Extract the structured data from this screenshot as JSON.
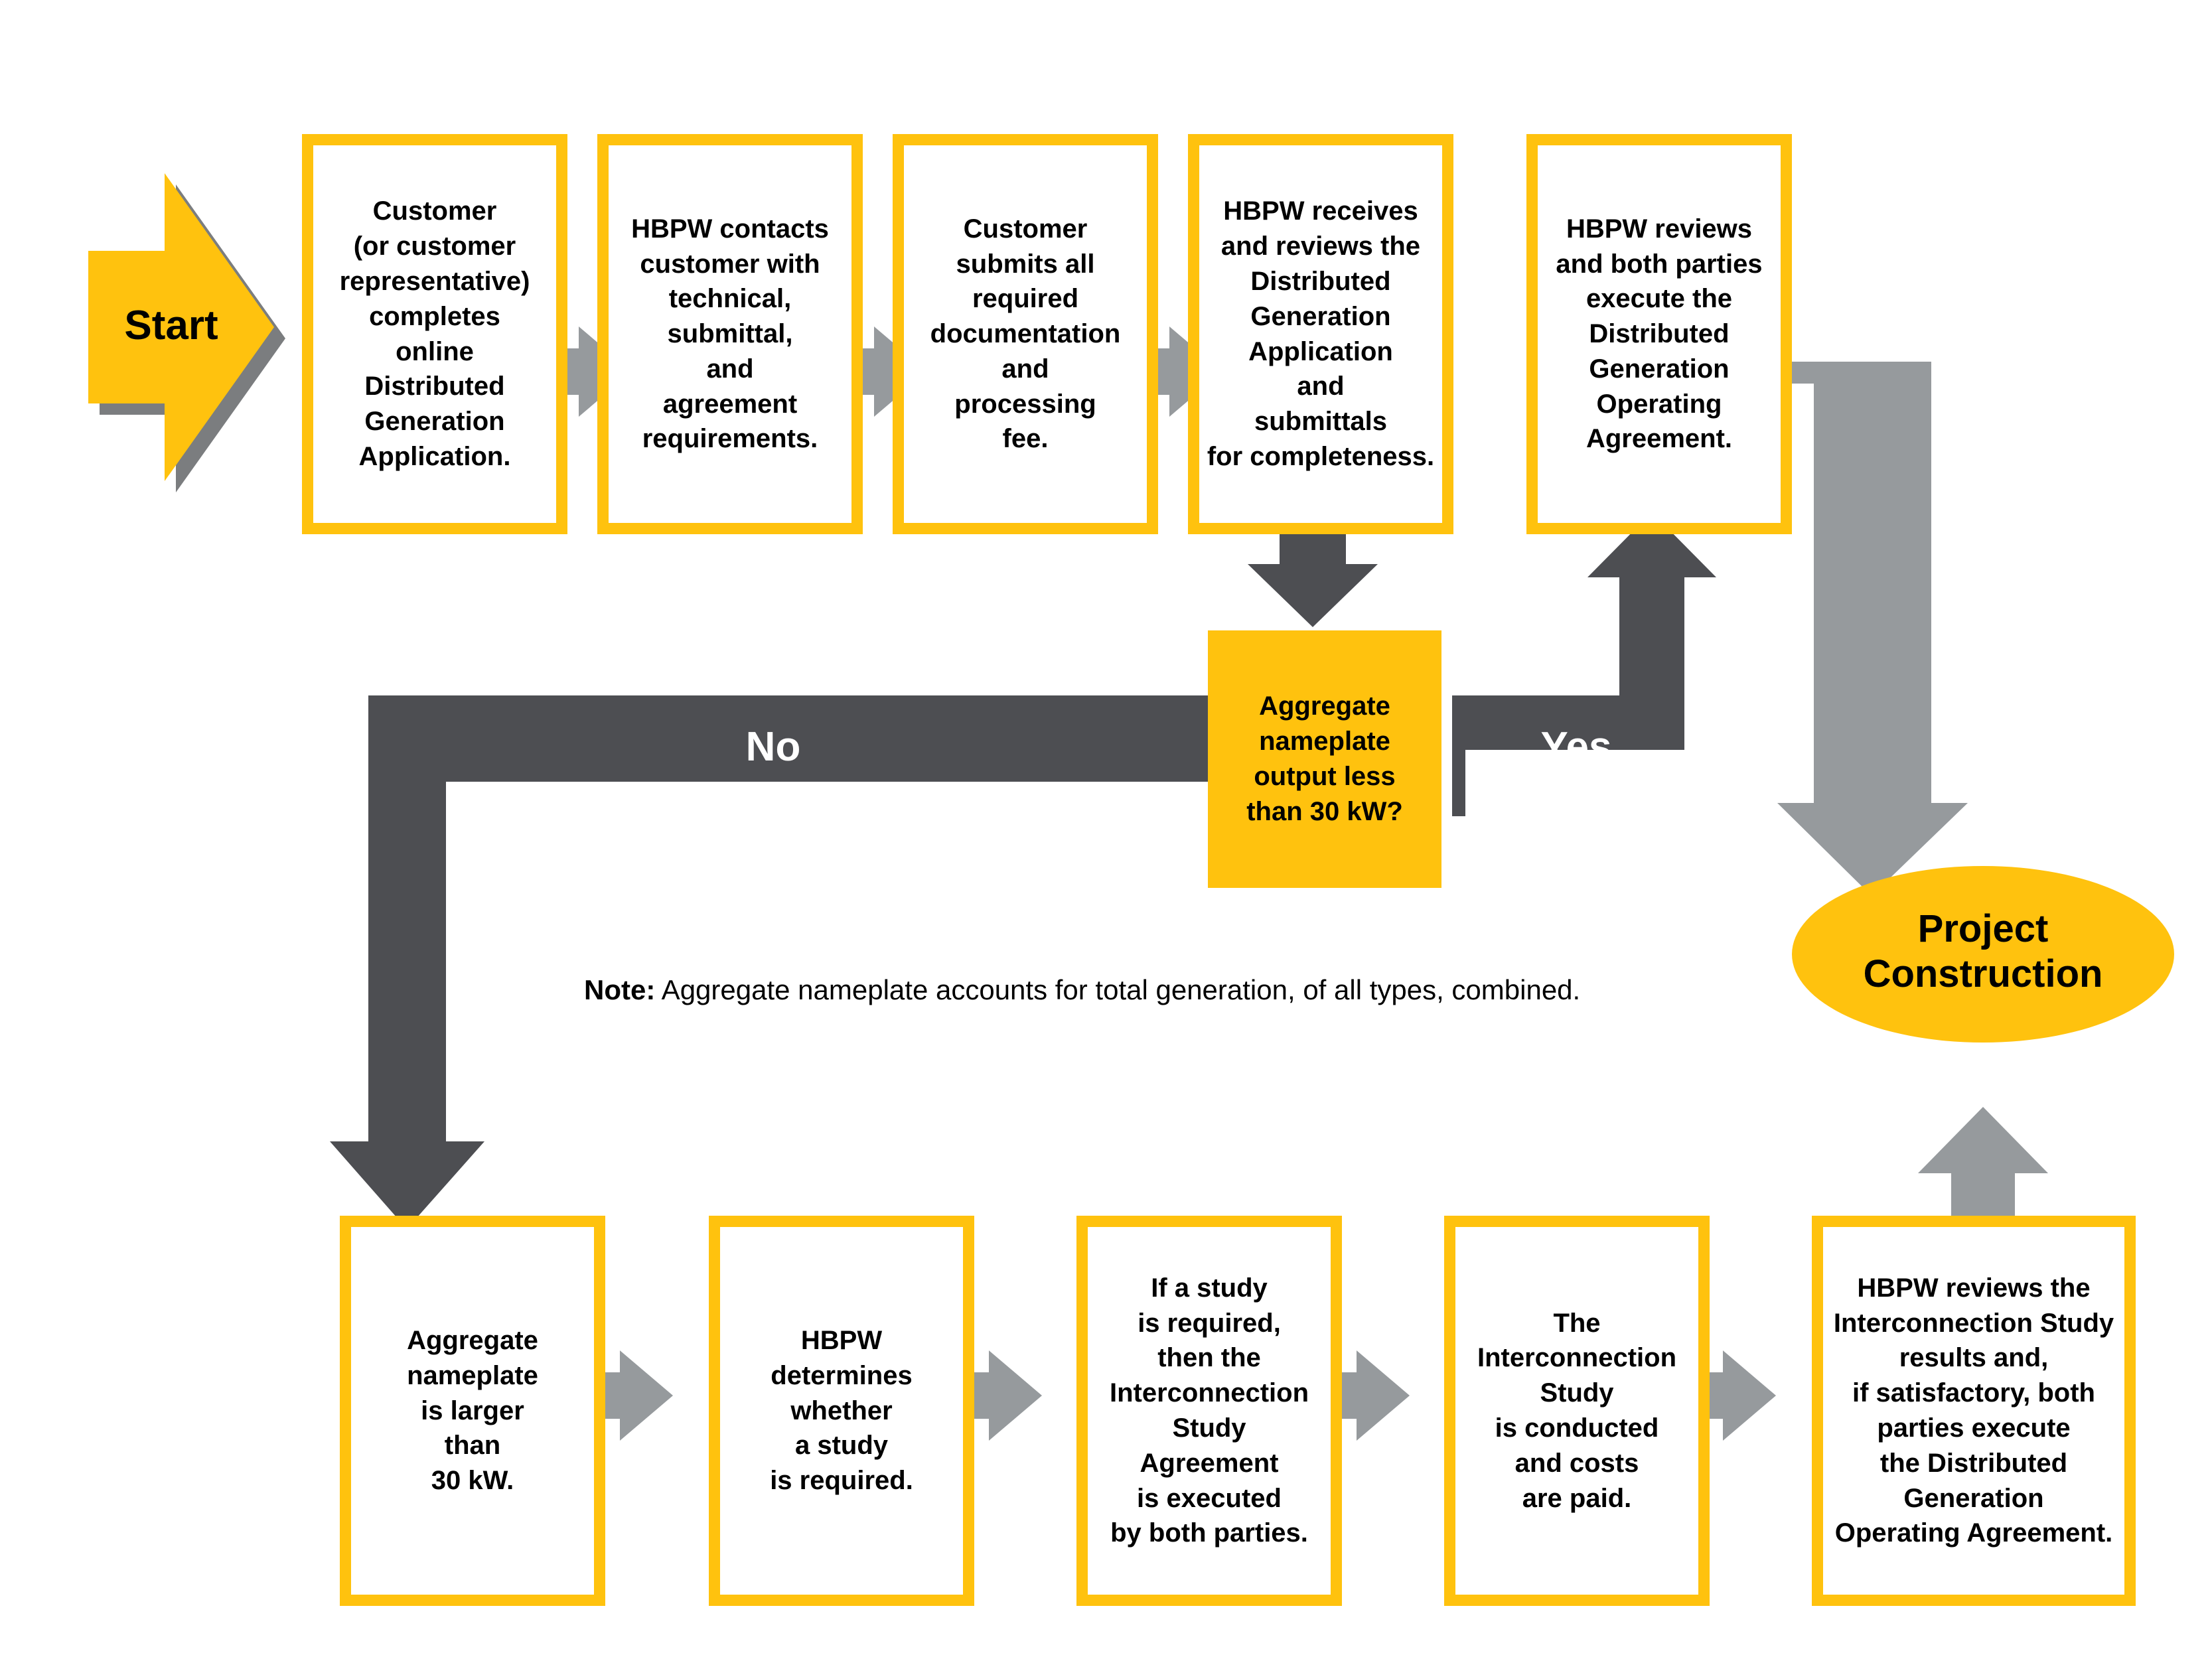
{
  "colors": {
    "yellow": "#FFC20E",
    "gray_light": "#969A9D",
    "gray_dark": "#4D4E52",
    "white": "#FFFFFF",
    "black": "#000000"
  },
  "start": {
    "label": "Start"
  },
  "top_row": {
    "steps": [
      {
        "id": "step-1",
        "text": "Customer\n(or customer\nrepresentative)\ncompletes\nonline\nDistributed\nGeneration\nApplication."
      },
      {
        "id": "step-2",
        "text": "HBPW contacts\ncustomer with\ntechnical,\nsubmittal,\nand\nagreement\nrequirements."
      },
      {
        "id": "step-3",
        "text": "Customer\nsubmits all\nrequired\ndocumentation\nand\nprocessing\nfee."
      },
      {
        "id": "step-4",
        "text": "HBPW receives\nand reviews the\nDistributed\nGeneration\nApplication\nand\nsubmittals\nfor completeness."
      },
      {
        "id": "step-5",
        "text": "HBPW reviews\nand both parties\nexecute the\nDistributed\nGeneration\nOperating\nAgreement."
      }
    ]
  },
  "decision": {
    "text": "Aggregate\nnameplate\noutput less\nthan 30 kW?",
    "yes_label": "Yes",
    "no_label": "No"
  },
  "note": {
    "prefix": "Note:",
    "body": " Aggregate nameplate accounts for total generation, of all types, combined."
  },
  "bottom_row": {
    "steps": [
      {
        "id": "step-6",
        "text": "Aggregate\nnameplate\nis larger\nthan\n30 kW."
      },
      {
        "id": "step-7",
        "text": "HBPW\ndetermines\nwhether\na study\nis required."
      },
      {
        "id": "step-8",
        "text": "If a study\nis required,\nthen the\nInterconnection\nStudy\nAgreement\nis executed\nby both parties."
      },
      {
        "id": "step-9",
        "text": "The\nInterconnection\nStudy\nis conducted\nand costs\nare paid."
      },
      {
        "id": "step-10",
        "text": "HBPW reviews the\nInterconnection Study\nresults and,\nif satisfactory, both\nparties execute\nthe Distributed\nGeneration\nOperating Agreement."
      }
    ]
  },
  "terminal": {
    "label": "Project\nConstruction"
  }
}
